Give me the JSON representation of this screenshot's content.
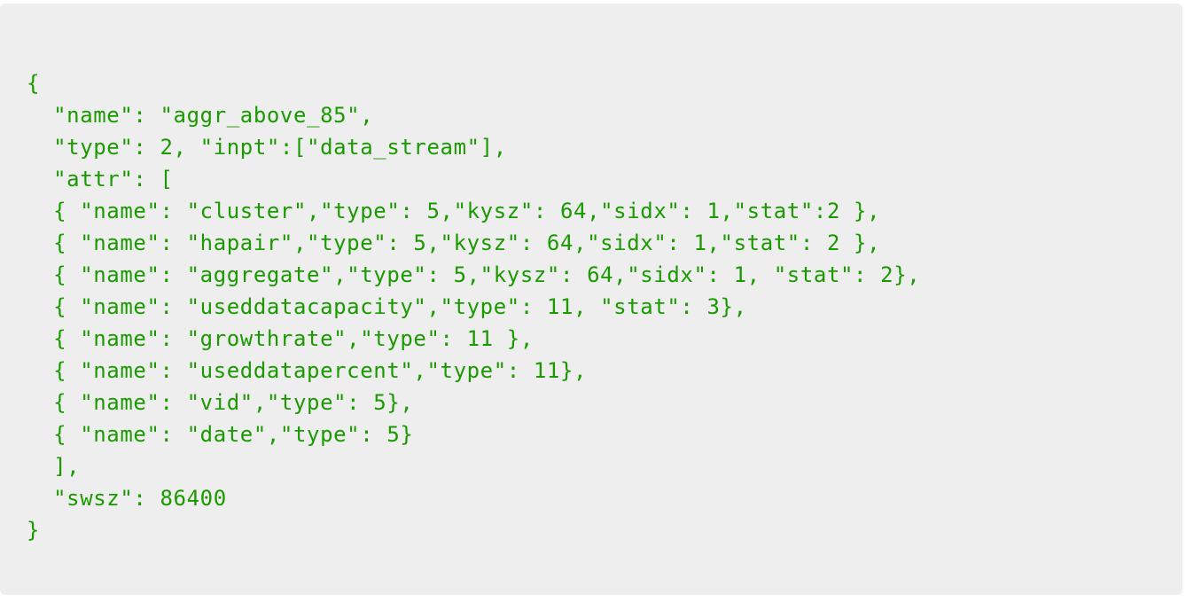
{
  "code": {
    "lines": [
      "{",
      "  \"name\": \"aggr_above_85\",",
      "  \"type\": 2, \"inpt\":[\"data_stream\"],",
      "  \"attr\": [",
      "  { \"name\": \"cluster\",\"type\": 5,\"kysz\": 64,\"sidx\": 1,\"stat\":2 },",
      "  { \"name\": \"hapair\",\"type\": 5,\"kysz\": 64,\"sidx\": 1,\"stat\": 2 },",
      "  { \"name\": \"aggregate\",\"type\": 5,\"kysz\": 64,\"sidx\": 1, \"stat\": 2},",
      "  { \"name\": \"useddatacapacity\",\"type\": 11, \"stat\": 3},",
      "  { \"name\": \"growthrate\",\"type\": 11 },",
      "  { \"name\": \"useddatapercent\",\"type\": 11},",
      "  { \"name\": \"vid\",\"type\": 5},",
      "  { \"name\": \"date\",\"type\": 5}",
      "  ],",
      "  \"swsz\": 86400",
      "}"
    ],
    "text_color": "#1a9a00",
    "background_color": "#eeeeee"
  }
}
